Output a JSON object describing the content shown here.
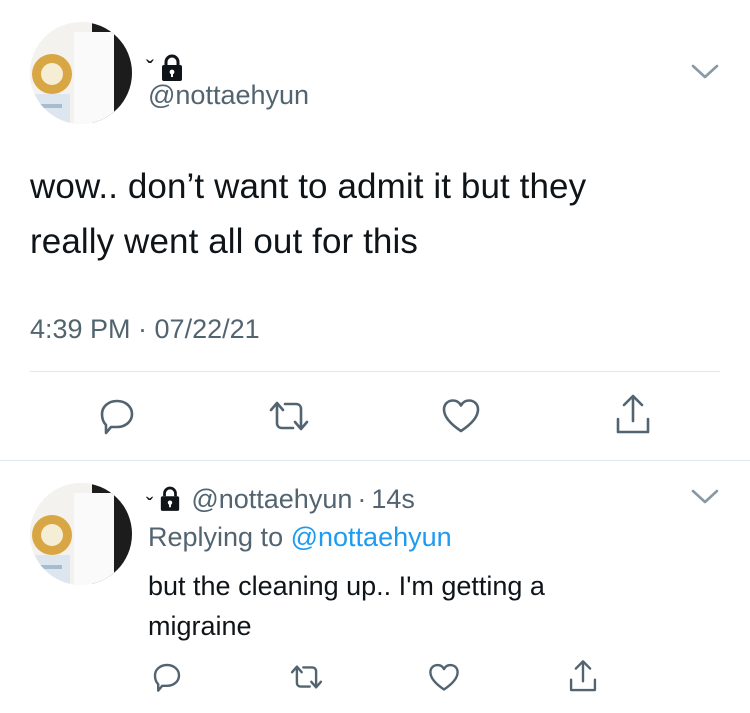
{
  "main_tweet": {
    "name_glyph": "ˇ",
    "handle": "@nottaehyun",
    "text_line1": "wow.. don’t want to admit it but they",
    "text_line2": "really went all out for this",
    "timestamp": "4:39 PM · 07/22/21"
  },
  "reply_tweet": {
    "name_glyph": "ˇ",
    "handle": "@nottaehyun",
    "separator": "·",
    "time_ago": "14s",
    "replying_prefix": "Replying to",
    "replying_handle": "@nottaehyun",
    "text_line1": "but the cleaning up.. I'm getting a",
    "text_line2": "migraine"
  },
  "colors": {
    "text": "#0f1419",
    "secondary": "#536471",
    "link": "#1d9bf0",
    "divider": "#e1e8ed",
    "icon": "#536471"
  },
  "icons": [
    "lock-icon",
    "chevron-down-icon",
    "reply-icon",
    "retweet-icon",
    "like-icon",
    "share-icon"
  ]
}
